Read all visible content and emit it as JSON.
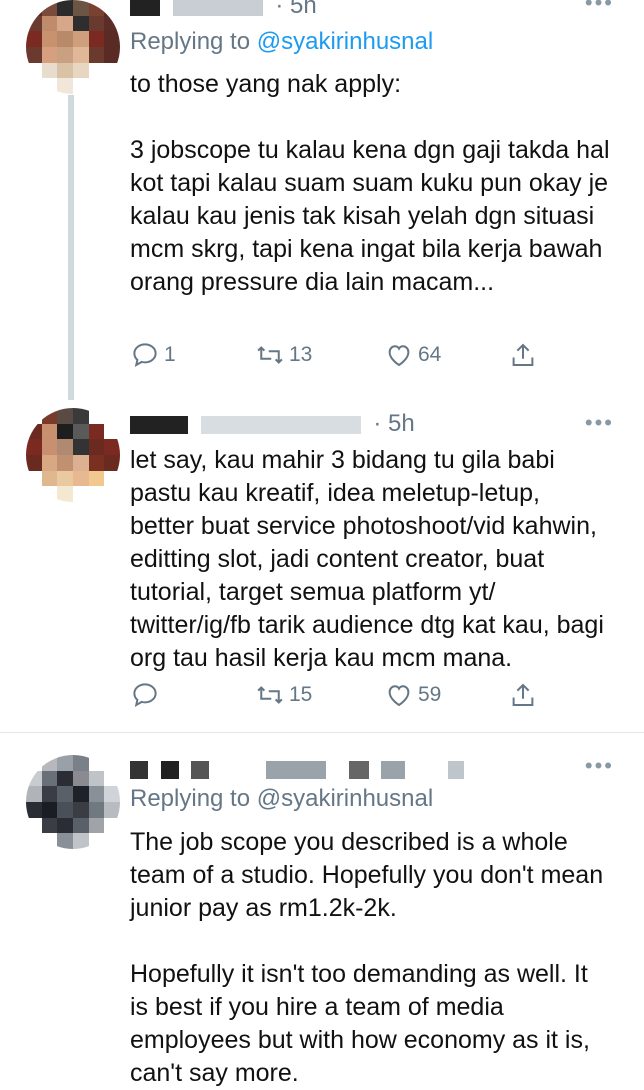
{
  "tweets": [
    {
      "time": "· 5h",
      "replying_prefix": "Replying to",
      "replying_handle": "@syakirinhusnal",
      "body": "to those yang nak apply:\n\n3 jobscope tu kalau kena dgn gaji takda hal kot tapi kalau suam suam kuku pun okay je kalau kau jenis tak kisah yelah dgn situasi mcm skrg, tapi kena ingat bila kerja bawah orang pressure dia lain macam...",
      "replies": "1",
      "retweets": "13",
      "likes": "64"
    },
    {
      "time": "· 5h",
      "body": "let say, kau mahir 3 bidang tu gila babi pastu kau kreatif, idea meletup-letup, better buat service photoshoot/vid kahwin, editting slot, jadi content creator, buat tutorial, target semua platform yt/ twitter/ig/fb tarik audience dtg kat kau, bagi org tau hasil kerja kau mcm mana.",
      "replies": "",
      "retweets": "15",
      "likes": "59"
    },
    {
      "replying_text": "Replying to @syakirinhusnal",
      "body": "The job scope you described is a whole team of a studio. Hopefully you don't mean junior pay as rm1.2k-2k.\n\nHopefully it isn't too demanding as well. It is best if you hire a team of media employees but with how economy as it is, can't say more."
    }
  ],
  "more_label": "•••",
  "colors": {
    "link": "#1d9bf0",
    "meta": "#657786",
    "text": "#111111",
    "divider": "#e1e8ed"
  }
}
